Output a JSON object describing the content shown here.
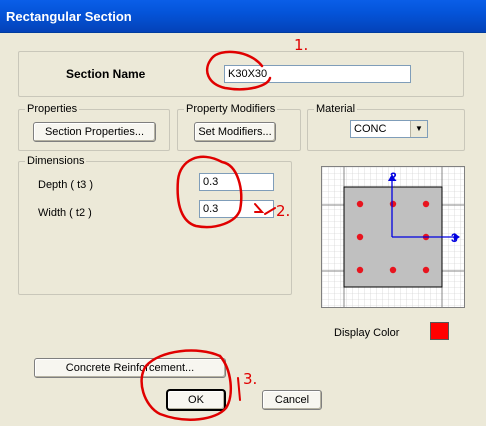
{
  "window": {
    "title": "Rectangular Section"
  },
  "section": {
    "label": "Section Name",
    "value": "K30X30"
  },
  "properties": {
    "title": "Properties",
    "button": "Section Properties..."
  },
  "modifiers": {
    "title": "Property Modifiers",
    "button": "Set Modifiers..."
  },
  "material": {
    "title": "Material",
    "selected": "CONC"
  },
  "dimensions": {
    "title": "Dimensions",
    "depth_label": "Depth  ( t3 )",
    "depth_value": "0.3",
    "width_label": "Width  ( t2 )",
    "width_value": "0.3"
  },
  "preview": {
    "axis2": "2",
    "axis3": "3",
    "fill": "#c0c0c0",
    "bar_color": "#e8141e",
    "axis_color": "#0000e0"
  },
  "display_color": {
    "label": "Display Color",
    "value": "#ff0000"
  },
  "reinforcement": {
    "button": "Concrete Reinforcement..."
  },
  "actions": {
    "ok": "OK",
    "cancel": "Cancel"
  },
  "annotations": {
    "n1": "1.",
    "n2": "2.",
    "n3": "3."
  }
}
